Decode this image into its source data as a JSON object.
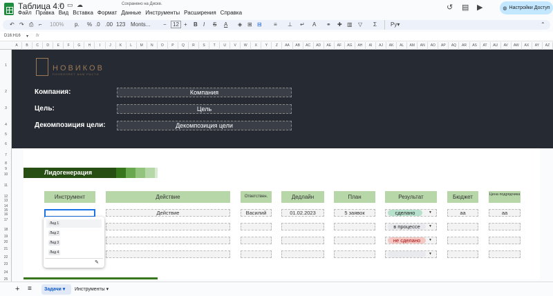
{
  "doc": {
    "title": "Таблица 4.0",
    "save_status": "Сохранено на Диске."
  },
  "menu": [
    "Файл",
    "Правка",
    "Вид",
    "Вставка",
    "Формат",
    "Данные",
    "Инструменты",
    "Расширения",
    "Справка"
  ],
  "share_label": "Настройки Доступ",
  "toolbar": {
    "zoom": "100%",
    "currency": "р.",
    "percent": "%",
    "dec1": ".0",
    "dec2": ".00",
    "num_format": "123",
    "font": "Monts...",
    "font_size": "12"
  },
  "formula_bar": {
    "cell_ref": "D16:H16",
    "fx": "fx"
  },
  "columns": [
    "A",
    "B",
    "C",
    "D",
    "E",
    "F",
    "G",
    "H",
    "I",
    "J",
    "K",
    "L",
    "M",
    "N",
    "O",
    "P",
    "Q",
    "R",
    "S",
    "T",
    "U",
    "V",
    "W",
    "X",
    "Y",
    "Z",
    "AA",
    "AB",
    "AC",
    "AD",
    "AE",
    "AF",
    "AG",
    "AH",
    "AI",
    "AJ",
    "AK",
    "AL",
    "AM",
    "AN",
    "AO",
    "AP",
    "AQ",
    "AR",
    "AS",
    "AT",
    "AU",
    "AV",
    "AW",
    "AX",
    "AY",
    "AZ"
  ],
  "rows": [
    "1",
    "2",
    "3",
    "4",
    "5",
    "6",
    "7",
    "8",
    "9",
    "10",
    "11",
    "12",
    "13",
    "14",
    "15",
    "16",
    "17",
    "18",
    "19",
    "20",
    "21",
    "22",
    "23",
    "24",
    "25"
  ],
  "brand": {
    "name": "НОВИКОВ",
    "sub": "ПОЗВОЛЯЕТ ВАМ РАСТИ"
  },
  "labels": {
    "company": "Компания:",
    "goal": "Цель:",
    "decomp": "Декомпозиция цели:"
  },
  "fields": {
    "company": "Компания",
    "goal": "Цель",
    "decomp": "Декомпозиция цели"
  },
  "section_title": "Лидогенерация",
  "table": {
    "headers": [
      "Инструмент",
      "Действие",
      "Ответствен.",
      "Дедлайн",
      "План",
      "Результат",
      "Бюджет",
      "Цена подрядчика"
    ],
    "row1": {
      "action": "Действие",
      "resp": "Василий",
      "deadline": "01.02.2023",
      "plan": "5 заявок",
      "budget": "аа",
      "price": "аа"
    },
    "results": [
      "сделано",
      "в процессе",
      "не сделано",
      ""
    ]
  },
  "dropdown": {
    "items": [
      "Лид 1",
      "Лид 2",
      "Лид 3",
      "Лид 4"
    ]
  },
  "tabs": {
    "active": "Задачи",
    "second": "Инструменты"
  },
  "colors": {
    "dark_bg": "#262a33",
    "accent_green": "#274e13",
    "header_green": "#b7d7a8",
    "done": "#b7e1cd",
    "doing": "#e8eaed",
    "not_done": "#f4c7c3"
  }
}
